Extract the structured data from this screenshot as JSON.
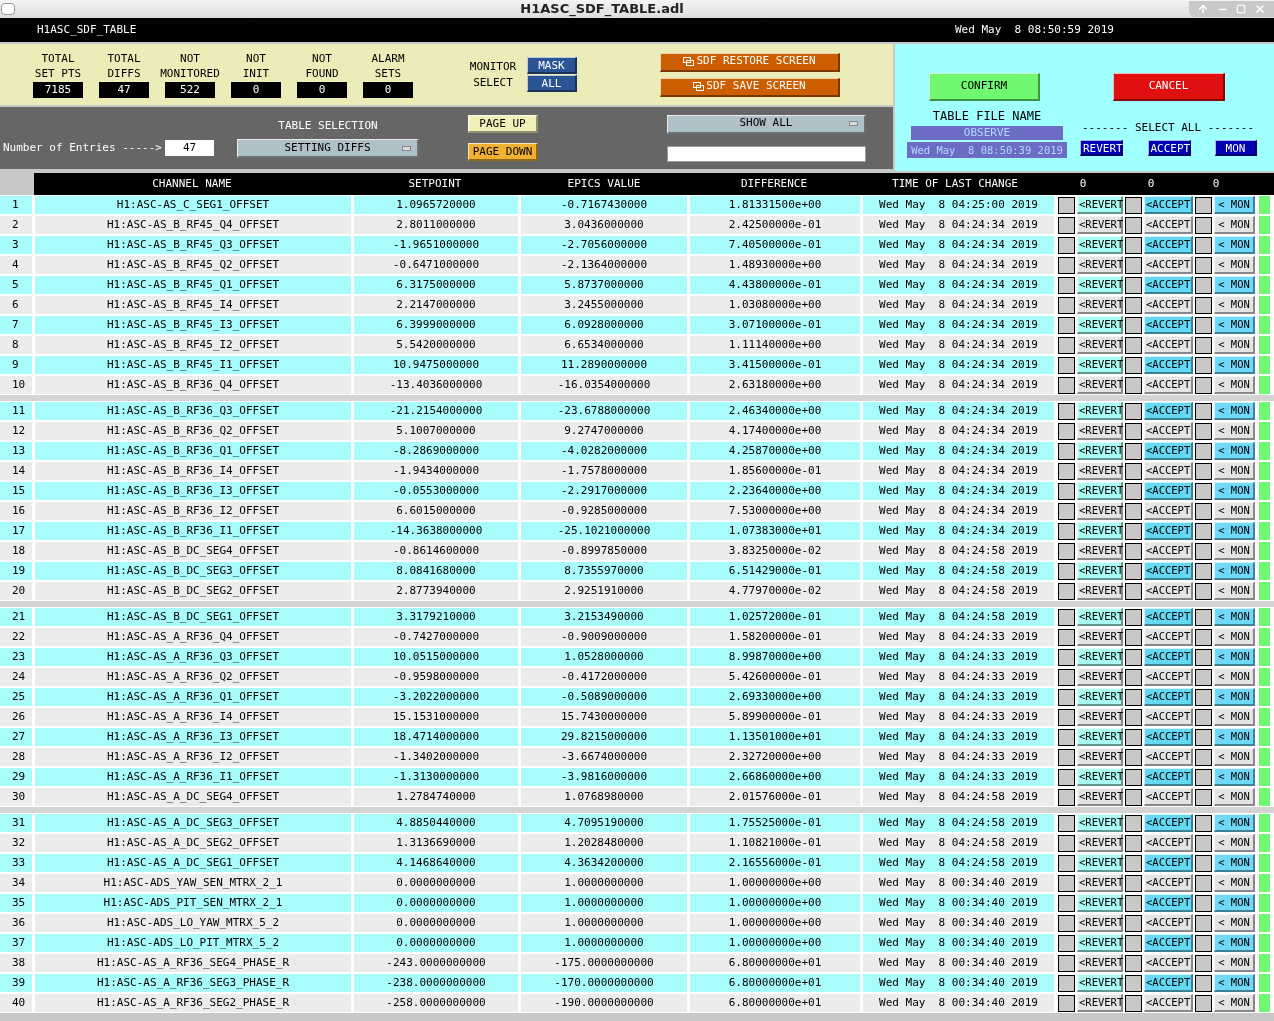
{
  "window": {
    "title": "H1ASC_SDF_TABLE.adl"
  },
  "header": {
    "screen_name": "H1ASC_SDF_TABLE",
    "clock": "Wed May  8 08:50:59 2019"
  },
  "stats": [
    {
      "label_lines": [
        "TOTAL",
        "SET PTS"
      ],
      "value": "7185"
    },
    {
      "label_lines": [
        "TOTAL",
        "DIFFS"
      ],
      "value": "47"
    },
    {
      "label_lines": [
        "NOT",
        "MONITORED"
      ],
      "value": "522"
    },
    {
      "label_lines": [
        "NOT",
        "INIT"
      ],
      "value": "0"
    },
    {
      "label_lines": [
        "NOT",
        "FOUND"
      ],
      "value": "0"
    },
    {
      "label_lines": [
        "ALARM",
        "SETS"
      ],
      "value": "0"
    }
  ],
  "monitor_select": {
    "label_lines": [
      "MONITOR",
      "SELECT"
    ],
    "buttons": [
      "MASK",
      "ALL"
    ]
  },
  "screen_buttons": [
    "SDF RESTORE SCREEN",
    "SDF SAVE SCREEN"
  ],
  "entries": {
    "label": "Number of Entries ----->",
    "value": "47"
  },
  "table_selection": {
    "label": "TABLE SELECTION",
    "value": "SETTING DIFFS"
  },
  "page_buttons": [
    "PAGE UP",
    "PAGE DOWN"
  ],
  "show_menu": {
    "value": "SHOW ALL"
  },
  "confirm": "CONFIRM",
  "cancel": "CANCEL",
  "table_file": {
    "label": "TABLE FILE NAME",
    "name": "OBSERVE",
    "time": "Wed May  8 08:50:39 2019"
  },
  "select_all": {
    "label": "------- SELECT ALL -------",
    "buttons": [
      "REVERT",
      "ACCEPT",
      "MON"
    ]
  },
  "columns": [
    "CHANNEL NAME",
    "SETPOINT",
    "EPICS VALUE",
    "DIFFERENCE",
    "TIME OF LAST CHANGE"
  ],
  "counts": [
    "0",
    "0",
    "0"
  ],
  "row_groups": [
    {
      "rows": [
        {
          "num": "1",
          "channel": "H1:ASC-AS_C_SEG1_OFFSET",
          "setpoint": "1.0965720000",
          "epics": "-0.7167430000",
          "diff": "1.81331500e+00",
          "time": "Wed May  8 04:25:00 2019",
          "actions": [
            {
              "label": "<REVERT",
              "checked": false
            },
            {
              "label": "<ACCEPT",
              "checked": false
            },
            {
              "label": "< MON",
              "checked": false
            }
          ]
        },
        {
          "num": "2",
          "channel": "H1:ASC-AS_B_RF45_Q4_OFFSET",
          "setpoint": "2.8011000000",
          "epics": "3.0436000000",
          "diff": "2.42500000e-01",
          "time": "Wed May  8 04:24:34 2019",
          "actions": [
            {
              "label": "<REVERT",
              "checked": false
            },
            {
              "label": "<ACCEPT",
              "checked": false
            },
            {
              "label": "< MON",
              "checked": false
            }
          ]
        },
        {
          "num": "3",
          "channel": "H1:ASC-AS_B_RF45_Q3_OFFSET",
          "setpoint": "-1.9651000000",
          "epics": "-2.7056000000",
          "diff": "7.40500000e-01",
          "time": "Wed May  8 04:24:34 2019",
          "actions": [
            {
              "label": "<REVERT",
              "checked": false
            },
            {
              "label": "<ACCEPT",
              "checked": false
            },
            {
              "label": "< MON",
              "checked": false
            }
          ]
        },
        {
          "num": "4",
          "channel": "H1:ASC-AS_B_RF45_Q2_OFFSET",
          "setpoint": "-0.6471000000",
          "epics": "-2.1364000000",
          "diff": "1.48930000e+00",
          "time": "Wed May  8 04:24:34 2019",
          "actions": [
            {
              "label": "<REVERT",
              "checked": false
            },
            {
              "label": "<ACCEPT",
              "checked": false
            },
            {
              "label": "< MON",
              "checked": false
            }
          ]
        },
        {
          "num": "5",
          "channel": "H1:ASC-AS_B_RF45_Q1_OFFSET",
          "setpoint": "6.3175000000",
          "epics": "5.8737000000",
          "diff": "4.43800000e-01",
          "time": "Wed May  8 04:24:34 2019",
          "actions": [
            {
              "label": "<REVERT",
              "checked": false
            },
            {
              "label": "<ACCEPT",
              "checked": false
            },
            {
              "label": "< MON",
              "checked": false
            }
          ]
        },
        {
          "num": "6",
          "channel": "H1:ASC-AS_B_RF45_I4_OFFSET",
          "setpoint": "2.2147000000",
          "epics": "3.2455000000",
          "diff": "1.03080000e+00",
          "time": "Wed May  8 04:24:34 2019",
          "actions": [
            {
              "label": "<REVERT",
              "checked": false
            },
            {
              "label": "<ACCEPT",
              "checked": false
            },
            {
              "label": "< MON",
              "checked": false
            }
          ]
        },
        {
          "num": "7",
          "channel": "H1:ASC-AS_B_RF45_I3_OFFSET",
          "setpoint": "6.3999000000",
          "epics": "6.0928000000",
          "diff": "3.07100000e-01",
          "time": "Wed May  8 04:24:34 2019",
          "actions": [
            {
              "label": "<REVERT",
              "checked": false
            },
            {
              "label": "<ACCEPT",
              "checked": false
            },
            {
              "label": "< MON",
              "checked": false
            }
          ]
        },
        {
          "num": "8",
          "channel": "H1:ASC-AS_B_RF45_I2_OFFSET",
          "setpoint": "5.5420000000",
          "epics": "6.6534000000",
          "diff": "1.11140000e+00",
          "time": "Wed May  8 04:24:34 2019",
          "actions": [
            {
              "label": "<REVERT",
              "checked": false
            },
            {
              "label": "<ACCEPT",
              "checked": false
            },
            {
              "label": "< MON",
              "checked": false
            }
          ]
        },
        {
          "num": "9",
          "channel": "H1:ASC-AS_B_RF45_I1_OFFSET",
          "setpoint": "10.9475000000",
          "epics": "11.2890000000",
          "diff": "3.41500000e-01",
          "time": "Wed May  8 04:24:34 2019",
          "actions": [
            {
              "label": "<REVERT",
              "checked": false
            },
            {
              "label": "<ACCEPT",
              "checked": false
            },
            {
              "label": "< MON",
              "checked": false
            }
          ]
        },
        {
          "num": "10",
          "channel": "H1:ASC-AS_B_RF36_Q4_OFFSET",
          "setpoint": "-13.4036000000",
          "epics": "-16.0354000000",
          "diff": "2.63180000e+00",
          "time": "Wed May  8 04:24:34 2019",
          "actions": [
            {
              "label": "<REVERT",
              "checked": false
            },
            {
              "label": "<ACCEPT",
              "checked": false
            },
            {
              "label": "< MON",
              "checked": false
            }
          ]
        }
      ]
    },
    {
      "rows": [
        {
          "num": "11",
          "channel": "H1:ASC-AS_B_RF36_Q3_OFFSET",
          "setpoint": "-21.2154000000",
          "epics": "-23.6788000000",
          "diff": "2.46340000e+00",
          "time": "Wed May  8 04:24:34 2019",
          "actions": [
            {
              "label": "<REVERT",
              "checked": false
            },
            {
              "label": "<ACCEPT",
              "checked": false
            },
            {
              "label": "< MON",
              "checked": false
            }
          ]
        },
        {
          "num": "12",
          "channel": "H1:ASC-AS_B_RF36_Q2_OFFSET",
          "setpoint": "5.1007000000",
          "epics": "9.2747000000",
          "diff": "4.17400000e+00",
          "time": "Wed May  8 04:24:34 2019",
          "actions": [
            {
              "label": "<REVERT",
              "checked": false
            },
            {
              "label": "<ACCEPT",
              "checked": false
            },
            {
              "label": "< MON",
              "checked": false
            }
          ]
        },
        {
          "num": "13",
          "channel": "H1:ASC-AS_B_RF36_Q1_OFFSET",
          "setpoint": "-8.2869000000",
          "epics": "-4.0282000000",
          "diff": "4.25870000e+00",
          "time": "Wed May  8 04:24:34 2019",
          "actions": [
            {
              "label": "<REVERT",
              "checked": false
            },
            {
              "label": "<ACCEPT",
              "checked": false
            },
            {
              "label": "< MON",
              "checked": false
            }
          ]
        },
        {
          "num": "14",
          "channel": "H1:ASC-AS_B_RF36_I4_OFFSET",
          "setpoint": "-1.9434000000",
          "epics": "-1.7578000000",
          "diff": "1.85600000e-01",
          "time": "Wed May  8 04:24:34 2019",
          "actions": [
            {
              "label": "<REVERT",
              "checked": false
            },
            {
              "label": "<ACCEPT",
              "checked": false
            },
            {
              "label": "< MON",
              "checked": false
            }
          ]
        },
        {
          "num": "15",
          "channel": "H1:ASC-AS_B_RF36_I3_OFFSET",
          "setpoint": "-0.0553000000",
          "epics": "-2.2917000000",
          "diff": "2.23640000e+00",
          "time": "Wed May  8 04:24:34 2019",
          "actions": [
            {
              "label": "<REVERT",
              "checked": false
            },
            {
              "label": "<ACCEPT",
              "checked": false
            },
            {
              "label": "< MON",
              "checked": false
            }
          ]
        },
        {
          "num": "16",
          "channel": "H1:ASC-AS_B_RF36_I2_OFFSET",
          "setpoint": "6.6015000000",
          "epics": "-0.9285000000",
          "diff": "7.53000000e+00",
          "time": "Wed May  8 04:24:34 2019",
          "actions": [
            {
              "label": "<REVERT",
              "checked": false
            },
            {
              "label": "<ACCEPT",
              "checked": false
            },
            {
              "label": "< MON",
              "checked": false
            }
          ]
        },
        {
          "num": "17",
          "channel": "H1:ASC-AS_B_RF36_I1_OFFSET",
          "setpoint": "-14.3638000000",
          "epics": "-25.1021000000",
          "diff": "1.07383000e+01",
          "time": "Wed May  8 04:24:34 2019",
          "actions": [
            {
              "label": "<REVERT",
              "checked": false
            },
            {
              "label": "<ACCEPT",
              "checked": false
            },
            {
              "label": "< MON",
              "checked": false
            }
          ]
        },
        {
          "num": "18",
          "channel": "H1:ASC-AS_B_DC_SEG4_OFFSET",
          "setpoint": "-0.8614600000",
          "epics": "-0.8997850000",
          "diff": "3.83250000e-02",
          "time": "Wed May  8 04:24:58 2019",
          "actions": [
            {
              "label": "<REVERT",
              "checked": false
            },
            {
              "label": "<ACCEPT",
              "checked": false
            },
            {
              "label": "< MON",
              "checked": false
            }
          ]
        },
        {
          "num": "19",
          "channel": "H1:ASC-AS_B_DC_SEG3_OFFSET",
          "setpoint": "8.0841680000",
          "epics": "8.7355970000",
          "diff": "6.51429000e-01",
          "time": "Wed May  8 04:24:58 2019",
          "actions": [
            {
              "label": "<REVERT",
              "checked": false
            },
            {
              "label": "<ACCEPT",
              "checked": false
            },
            {
              "label": "< MON",
              "checked": false
            }
          ]
        },
        {
          "num": "20",
          "channel": "H1:ASC-AS_B_DC_SEG2_OFFSET",
          "setpoint": "2.8773940000",
          "epics": "2.9251910000",
          "diff": "4.77970000e-02",
          "time": "Wed May  8 04:24:58 2019",
          "actions": [
            {
              "label": "<REVERT",
              "checked": false
            },
            {
              "label": "<ACCEPT",
              "checked": false
            },
            {
              "label": "< MON",
              "checked": false
            }
          ]
        }
      ]
    },
    {
      "rows": [
        {
          "num": "21",
          "channel": "H1:ASC-AS_B_DC_SEG1_OFFSET",
          "setpoint": "3.3179210000",
          "epics": "3.2153490000",
          "diff": "1.02572000e-01",
          "time": "Wed May  8 04:24:58 2019",
          "actions": [
            {
              "label": "<REVERT",
              "checked": false
            },
            {
              "label": "<ACCEPT",
              "checked": false
            },
            {
              "label": "< MON",
              "checked": false
            }
          ]
        },
        {
          "num": "22",
          "channel": "H1:ASC-AS_A_RF36_Q4_OFFSET",
          "setpoint": "-0.7427000000",
          "epics": "-0.9009000000",
          "diff": "1.58200000e-01",
          "time": "Wed May  8 04:24:33 2019",
          "actions": [
            {
              "label": "<REVERT",
              "checked": false
            },
            {
              "label": "<ACCEPT",
              "checked": false
            },
            {
              "label": "< MON",
              "checked": false
            }
          ]
        },
        {
          "num": "23",
          "channel": "H1:ASC-AS_A_RF36_Q3_OFFSET",
          "setpoint": "10.0515000000",
          "epics": "1.0528000000",
          "diff": "8.99870000e+00",
          "time": "Wed May  8 04:24:33 2019",
          "actions": [
            {
              "label": "<REVERT",
              "checked": false
            },
            {
              "label": "<ACCEPT",
              "checked": false
            },
            {
              "label": "< MON",
              "checked": false
            }
          ]
        },
        {
          "num": "24",
          "channel": "H1:ASC-AS_A_RF36_Q2_OFFSET",
          "setpoint": "-0.9598000000",
          "epics": "-0.4172000000",
          "diff": "5.42600000e-01",
          "time": "Wed May  8 04:24:33 2019",
          "actions": [
            {
              "label": "<REVERT",
              "checked": false
            },
            {
              "label": "<ACCEPT",
              "checked": false
            },
            {
              "label": "< MON",
              "checked": false
            }
          ]
        },
        {
          "num": "25",
          "channel": "H1:ASC-AS_A_RF36_Q1_OFFSET",
          "setpoint": "-3.2022000000",
          "epics": "-0.5089000000",
          "diff": "2.69330000e+00",
          "time": "Wed May  8 04:24:33 2019",
          "actions": [
            {
              "label": "<REVERT",
              "checked": false
            },
            {
              "label": "<ACCEPT",
              "checked": false
            },
            {
              "label": "< MON",
              "checked": false
            }
          ]
        },
        {
          "num": "26",
          "channel": "H1:ASC-AS_A_RF36_I4_OFFSET",
          "setpoint": "15.1531000000",
          "epics": "15.7430000000",
          "diff": "5.89900000e-01",
          "time": "Wed May  8 04:24:33 2019",
          "actions": [
            {
              "label": "<REVERT",
              "checked": false
            },
            {
              "label": "<ACCEPT",
              "checked": false
            },
            {
              "label": "< MON",
              "checked": false
            }
          ]
        },
        {
          "num": "27",
          "channel": "H1:ASC-AS_A_RF36_I3_OFFSET",
          "setpoint": "18.4714000000",
          "epics": "29.8215000000",
          "diff": "1.13501000e+01",
          "time": "Wed May  8 04:24:33 2019",
          "actions": [
            {
              "label": "<REVERT",
              "checked": false
            },
            {
              "label": "<ACCEPT",
              "checked": false
            },
            {
              "label": "< MON",
              "checked": false
            }
          ]
        },
        {
          "num": "28",
          "channel": "H1:ASC-AS_A_RF36_I2_OFFSET",
          "setpoint": "-1.3402000000",
          "epics": "-3.6674000000",
          "diff": "2.32720000e+00",
          "time": "Wed May  8 04:24:33 2019",
          "actions": [
            {
              "label": "<REVERT",
              "checked": false
            },
            {
              "label": "<ACCEPT",
              "checked": false
            },
            {
              "label": "< MON",
              "checked": false
            }
          ]
        },
        {
          "num": "29",
          "channel": "H1:ASC-AS_A_RF36_I1_OFFSET",
          "setpoint": "-1.3130000000",
          "epics": "-3.9816000000",
          "diff": "2.66860000e+00",
          "time": "Wed May  8 04:24:33 2019",
          "actions": [
            {
              "label": "<REVERT",
              "checked": false
            },
            {
              "label": "<ACCEPT",
              "checked": false
            },
            {
              "label": "< MON",
              "checked": false
            }
          ]
        },
        {
          "num": "30",
          "channel": "H1:ASC-AS_A_DC_SEG4_OFFSET",
          "setpoint": "1.2784740000",
          "epics": "1.0768980000",
          "diff": "2.01576000e-01",
          "time": "Wed May  8 04:24:58 2019",
          "actions": [
            {
              "label": "<REVERT",
              "checked": false
            },
            {
              "label": "<ACCEPT",
              "checked": false
            },
            {
              "label": "< MON",
              "checked": false
            }
          ]
        }
      ]
    },
    {
      "rows": [
        {
          "num": "31",
          "channel": "H1:ASC-AS_A_DC_SEG3_OFFSET",
          "setpoint": "4.8850440000",
          "epics": "4.7095190000",
          "diff": "1.75525000e-01",
          "time": "Wed May  8 04:24:58 2019",
          "actions": [
            {
              "label": "<REVERT",
              "checked": false
            },
            {
              "label": "<ACCEPT",
              "checked": false
            },
            {
              "label": "< MON",
              "checked": false
            }
          ]
        },
        {
          "num": "32",
          "channel": "H1:ASC-AS_A_DC_SEG2_OFFSET",
          "setpoint": "1.3136690000",
          "epics": "1.2028480000",
          "diff": "1.10821000e-01",
          "time": "Wed May  8 04:24:58 2019",
          "actions": [
            {
              "label": "<REVERT",
              "checked": false
            },
            {
              "label": "<ACCEPT",
              "checked": false
            },
            {
              "label": "< MON",
              "checked": false
            }
          ]
        },
        {
          "num": "33",
          "channel": "H1:ASC-AS_A_DC_SEG1_OFFSET",
          "setpoint": "4.1468640000",
          "epics": "4.3634200000",
          "diff": "2.16556000e-01",
          "time": "Wed May  8 04:24:58 2019",
          "actions": [
            {
              "label": "<REVERT",
              "checked": false
            },
            {
              "label": "<ACCEPT",
              "checked": false
            },
            {
              "label": "< MON",
              "checked": false
            }
          ]
        },
        {
          "num": "34",
          "channel": "H1:ASC-ADS_YAW_SEN_MTRX_2_1",
          "setpoint": "0.0000000000",
          "epics": "1.0000000000",
          "diff": "1.00000000e+00",
          "time": "Wed May  8 00:34:40 2019",
          "actions": [
            {
              "label": "<REVERT",
              "checked": false
            },
            {
              "label": "<ACCEPT",
              "checked": false
            },
            {
              "label": "< MON",
              "checked": false
            }
          ]
        },
        {
          "num": "35",
          "channel": "H1:ASC-ADS_PIT_SEN_MTRX_2_1",
          "setpoint": "0.0000000000",
          "epics": "1.0000000000",
          "diff": "1.00000000e+00",
          "time": "Wed May  8 00:34:40 2019",
          "actions": [
            {
              "label": "<REVERT",
              "checked": false
            },
            {
              "label": "<ACCEPT",
              "checked": false
            },
            {
              "label": "< MON",
              "checked": false
            }
          ]
        },
        {
          "num": "36",
          "channel": "H1:ASC-ADS_LO_YAW_MTRX_5_2",
          "setpoint": "0.0000000000",
          "epics": "1.0000000000",
          "diff": "1.00000000e+00",
          "time": "Wed May  8 00:34:40 2019",
          "actions": [
            {
              "label": "<REVERT",
              "checked": false
            },
            {
              "label": "<ACCEPT",
              "checked": false
            },
            {
              "label": "< MON",
              "checked": false
            }
          ]
        },
        {
          "num": "37",
          "channel": "H1:ASC-ADS_LO_PIT_MTRX_5_2",
          "setpoint": "0.0000000000",
          "epics": "1.0000000000",
          "diff": "1.00000000e+00",
          "time": "Wed May  8 00:34:40 2019",
          "actions": [
            {
              "label": "<REVERT",
              "checked": false
            },
            {
              "label": "<ACCEPT",
              "checked": false
            },
            {
              "label": "< MON",
              "checked": false
            }
          ]
        },
        {
          "num": "38",
          "channel": "H1:ASC-AS_A_RF36_SEG4_PHASE_R",
          "setpoint": "-243.0000000000",
          "epics": "-175.0000000000",
          "diff": "6.80000000e+01",
          "time": "Wed May  8 00:34:40 2019",
          "actions": [
            {
              "label": "<REVERT",
              "checked": false
            },
            {
              "label": "<ACCEPT",
              "checked": false
            },
            {
              "label": "< MON",
              "checked": false
            }
          ]
        },
        {
          "num": "39",
          "channel": "H1:ASC-AS_A_RF36_SEG3_PHASE_R",
          "setpoint": "-238.0000000000",
          "epics": "-170.0000000000",
          "diff": "6.80000000e+01",
          "time": "Wed May  8 00:34:40 2019",
          "actions": [
            {
              "label": "<REVERT",
              "checked": false
            },
            {
              "label": "<ACCEPT",
              "checked": false
            },
            {
              "label": "< MON",
              "checked": false
            }
          ]
        },
        {
          "num": "40",
          "channel": "H1:ASC-AS_A_RF36_SEG2_PHASE_R",
          "setpoint": "-258.0000000000",
          "epics": "-190.0000000000",
          "diff": "6.80000000e+01",
          "time": "Wed May  8 00:34:40 2019",
          "actions": [
            {
              "label": "<REVERT",
              "checked": false
            },
            {
              "label": "<ACCEPT",
              "checked": false
            },
            {
              "label": "< MON",
              "checked": false
            }
          ]
        }
      ]
    }
  ]
}
